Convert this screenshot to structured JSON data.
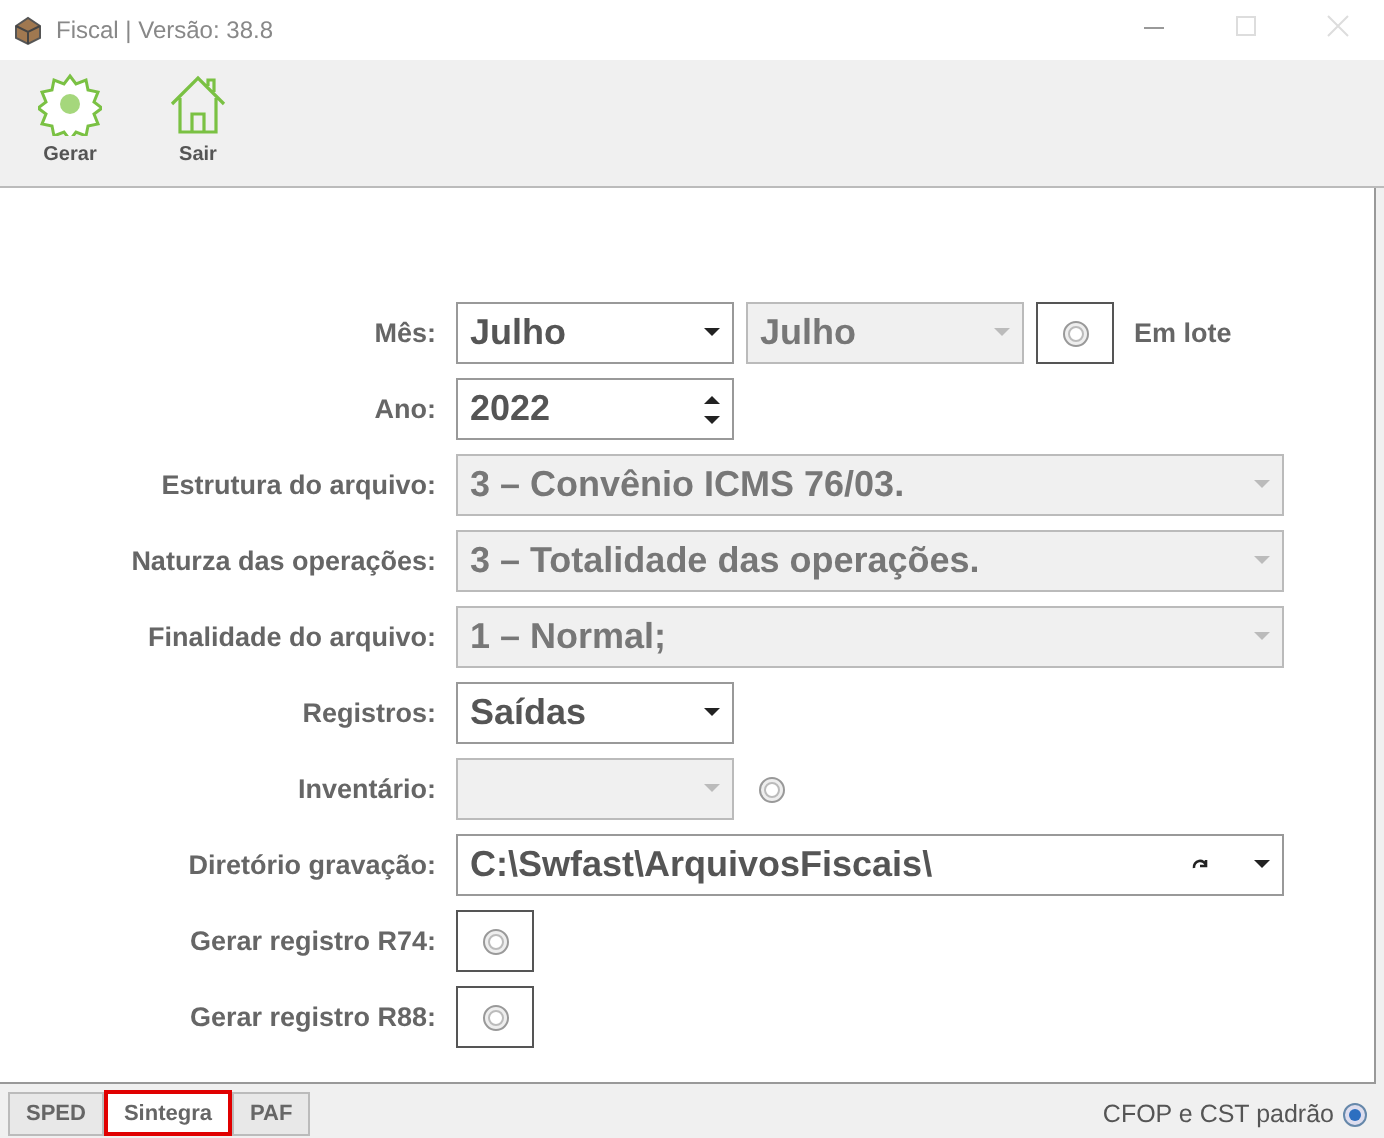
{
  "window": {
    "title": "Fiscal | Versão: 38.8"
  },
  "toolbar": [
    {
      "kind": "gear",
      "label": "Gerar"
    },
    {
      "kind": "house",
      "label": "Sair"
    }
  ],
  "form": [
    {
      "label": "Mês:",
      "controls": [
        {
          "kind": "dropdown",
          "value": "Julho",
          "disabled": false
        },
        {
          "kind": "dropdown",
          "value": "Julho",
          "disabled": true
        },
        {
          "kind": "radio-box",
          "checked": false
        },
        {
          "kind": "text",
          "text": "Em lote"
        }
      ]
    },
    {
      "label": "Ano:",
      "controls": [
        {
          "kind": "spinner",
          "value": "2022"
        }
      ]
    },
    {
      "label": "Estrutura do arquivo:",
      "controls": [
        {
          "kind": "long-dropdown",
          "value": "3 – Convênio ICMS 76/03.",
          "disabled": true
        }
      ]
    },
    {
      "label": "Naturza das operações:",
      "controls": [
        {
          "kind": "long-dropdown",
          "value": "3 – Totalidade das operações.",
          "disabled": true
        }
      ]
    },
    {
      "label": "Finalidade do arquivo:",
      "controls": [
        {
          "kind": "long-dropdown",
          "value": "1 – Normal;",
          "disabled": true
        }
      ]
    },
    {
      "label": "Registros:",
      "controls": [
        {
          "kind": "dropdown",
          "value": "Saídas",
          "disabled": false
        }
      ]
    },
    {
      "label": "Inventário:",
      "controls": [
        {
          "kind": "dropdown",
          "disabled": true
        },
        {
          "kind": "radio",
          "checked": false
        }
      ]
    },
    {
      "label": "Diretório gravação:",
      "controls": [
        {
          "kind": "path",
          "value": "C:\\Swfast\\ArquivosFiscais\\"
        }
      ]
    },
    {
      "label": "Gerar registro R74:",
      "controls": [
        {
          "kind": "radio-box",
          "checked": false
        }
      ]
    },
    {
      "label": "Gerar registro R88:",
      "controls": [
        {
          "kind": "radio-box",
          "checked": false
        }
      ]
    }
  ],
  "tabs": [
    {
      "label": "SPED",
      "selected": false
    },
    {
      "label": "Sintegra",
      "selected": true
    },
    {
      "label": "PAF",
      "selected": false
    }
  ],
  "status": {
    "label": "CFOP e CST padrão",
    "checked": true
  }
}
